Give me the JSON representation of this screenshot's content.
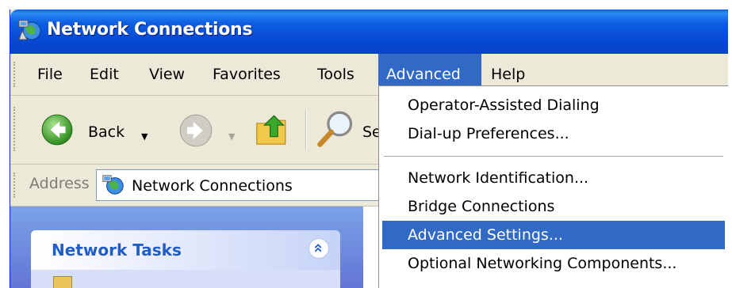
{
  "window": {
    "title": "Network Connections",
    "title_icon": "network-connections-icon"
  },
  "menubar": {
    "items": [
      {
        "label": "File"
      },
      {
        "label": "Edit"
      },
      {
        "label": "View"
      },
      {
        "label": "Favorites"
      },
      {
        "label": "Tools"
      },
      {
        "label": "Advanced",
        "active": true
      },
      {
        "label": "Help"
      }
    ]
  },
  "toolbar": {
    "back_label": "Back",
    "back_icon": "back-arrow-icon",
    "forward_icon": "forward-arrow-icon",
    "up_icon": "up-folder-icon",
    "search_label": "Se",
    "search_icon": "search-magnifier-icon"
  },
  "address": {
    "label": "Address",
    "value": "Network Connections",
    "icon": "network-connections-icon"
  },
  "taskpane": {
    "title": "Network Tasks",
    "collapse_icon": "collapse-chevron-icon"
  },
  "dropdown": {
    "groups": [
      [
        {
          "label": "Operator-Assisted Dialing"
        },
        {
          "label": "Dial-up Preferences..."
        }
      ],
      [
        {
          "label": "Network Identification..."
        },
        {
          "label": "Bridge Connections"
        },
        {
          "label": "Advanced Settings...",
          "highlighted": true
        },
        {
          "label": "Optional Networking Components..."
        }
      ]
    ]
  },
  "colors": {
    "titlebar": "#0748d2",
    "menu_highlight": "#316ac5",
    "chrome": "#ece9d8",
    "taskpane": "#7ba2e7"
  }
}
